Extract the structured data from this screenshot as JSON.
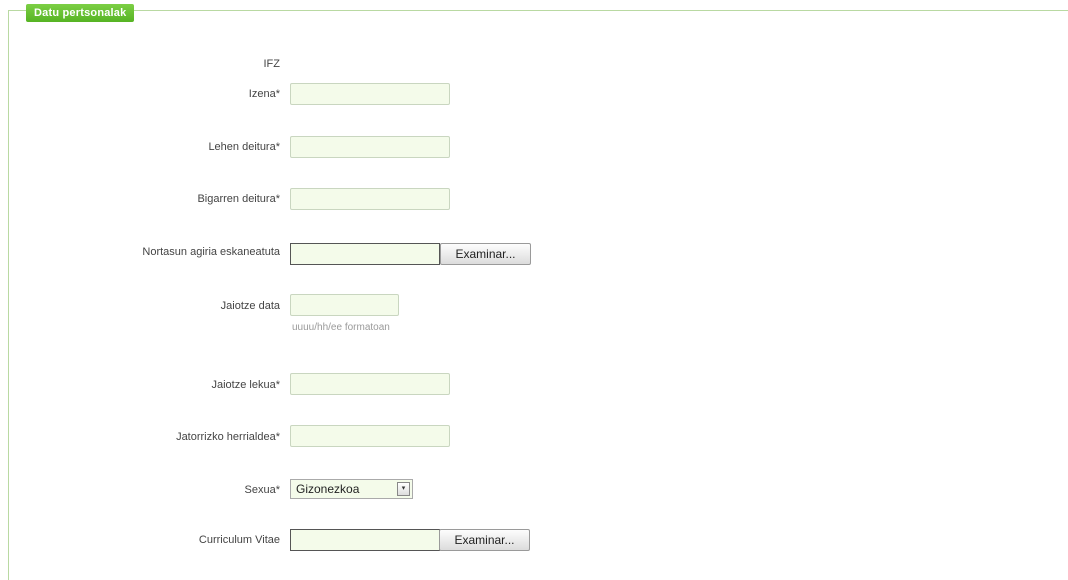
{
  "section": {
    "legend": "Datu pertsonalak"
  },
  "fields": {
    "ifz": {
      "label": "IFZ"
    },
    "izena": {
      "label": "Izena*"
    },
    "lehen_deitura": {
      "label": "Lehen deitura*"
    },
    "bigarren_deitura": {
      "label": "Bigarren deitura*"
    },
    "nortasun_agiria": {
      "label": "Nortasun agiria eskaneatuta",
      "button": "Examinar..."
    },
    "jaiotze_data": {
      "label": "Jaiotze data",
      "hint": "uuuu/hh/ee formatoan"
    },
    "jaiotze_lekua": {
      "label": "Jaiotze lekua*"
    },
    "jatorrizko_herrialdea": {
      "label": "Jatorrizko herrialdea*"
    },
    "sexua": {
      "label": "Sexua*",
      "selected": "Gizonezkoa",
      "arrow_icon": "▾"
    },
    "cv": {
      "label": "Curriculum Vitae",
      "button": "Examinar..."
    }
  }
}
